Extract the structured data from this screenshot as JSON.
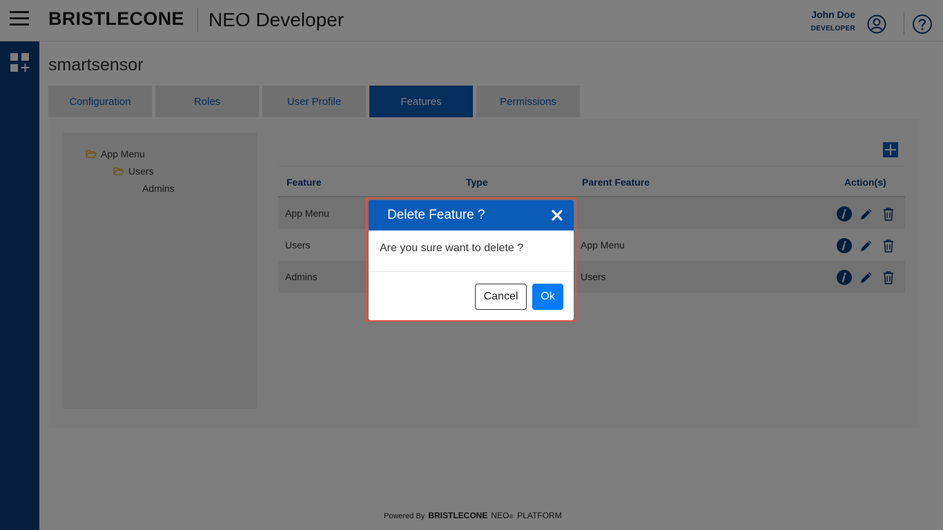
{
  "header": {
    "brand": "BRISTLECONE",
    "app_title": "NEO Developer",
    "user_name": "John Doe",
    "user_role": "DEVELOPER"
  },
  "page": {
    "title": "smartsensor"
  },
  "tabs": [
    {
      "label": "Configuration",
      "active": false
    },
    {
      "label": "Roles",
      "active": false
    },
    {
      "label": "User Profile",
      "active": false
    },
    {
      "label": "Features",
      "active": true
    },
    {
      "label": "Permissions",
      "active": false
    }
  ],
  "tree": {
    "items": [
      {
        "label": "App Menu",
        "icon": "folder-open-icon"
      },
      {
        "label": "Users",
        "icon": "folder-open-icon"
      },
      {
        "label": "Admins"
      }
    ]
  },
  "table": {
    "headers": {
      "feature": "Feature",
      "type": "Type",
      "parent": "Parent Feature",
      "actions": "Action(s)"
    },
    "rows": [
      {
        "feature": "App Menu",
        "type": "",
        "parent": ""
      },
      {
        "feature": "Users",
        "type": "",
        "parent": "App Menu"
      },
      {
        "feature": "Admins",
        "type": "",
        "parent": "Users"
      }
    ]
  },
  "footer": {
    "powered_by": "Powered By",
    "brand": "BRISTLECONE",
    "neo": "NEO",
    "reg": "®",
    "platform": "PLATFORM"
  },
  "modal": {
    "title": "Delete Feature ?",
    "message": "Are you sure want to delete ?",
    "cancel_label": "Cancel",
    "ok_label": "Ok"
  },
  "colors": {
    "brand_blue": "#0a3d7a",
    "tab_active": "#0a5cb8",
    "ok_button": "#007bff",
    "folder": "#e8a317"
  }
}
